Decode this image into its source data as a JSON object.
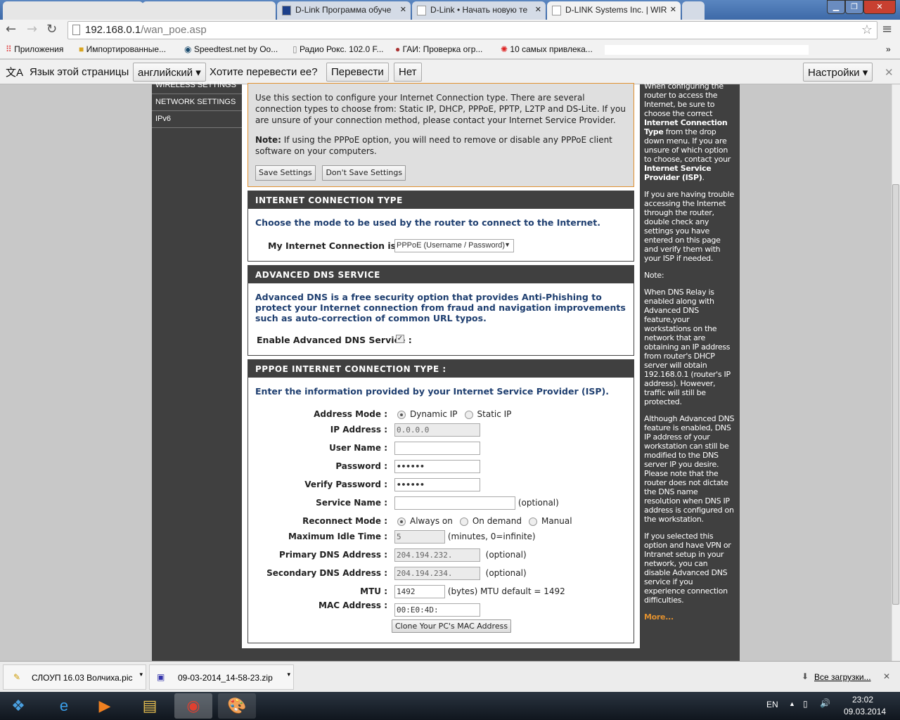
{
  "browser": {
    "tabs": [
      {
        "title": "D-Link Программа обуче"
      },
      {
        "title": "D-Link • Начать новую те"
      },
      {
        "title": "D-LINK Systems Inc. | WIR"
      }
    ],
    "url_host": "192.168.0.1",
    "url_path": "/wan_poe.asp",
    "bookmarks": [
      "Приложения",
      "Импортированные...",
      "Speedtest.net by Oo...",
      "Радио Рокс. 102.0 F...",
      "ГАИ: Проверка огр...",
      "10 самых привлека..."
    ],
    "translate": {
      "prefix": "Язык этой страницы",
      "language": "английский",
      "question": "Хотите перевести ее?",
      "translate": "Перевести",
      "no": "Нет",
      "settings": "Настройки"
    }
  },
  "nav": {
    "items": [
      "WIRELESS SETTINGS",
      "NETWORK SETTINGS",
      "IPv6"
    ]
  },
  "intro": {
    "text": "Use this section to configure your Internet Connection type. There are several connection types to choose from: Static IP, DHCP, PPPoE, PPTP, L2TP and DS-Lite. If you are unsure of your connection method, please contact your Internet Service Provider.",
    "note_label": "Note:",
    "note": " If using the PPPoE option, you will need to remove or disable any PPPoE client software on your computers.",
    "save": "Save Settings",
    "dont_save": "Don't Save Settings"
  },
  "ict": {
    "title": "INTERNET CONNECTION TYPE",
    "desc": "Choose the mode to be used by the router to connect to the Internet.",
    "label": "My Internet Connection is :",
    "value": "PPPoE (Username / Password)"
  },
  "dns": {
    "title": "ADVANCED DNS SERVICE",
    "desc": "Advanced DNS is a free security option that provides Anti-Phishing to protect your Internet connection from fraud and navigation improvements such as auto-correction of common URL typos.",
    "label": "Enable Advanced DNS Service :",
    "checked": true
  },
  "pppoe": {
    "title": "PPPOE INTERNET CONNECTION TYPE :",
    "desc": "Enter the information provided by your Internet Service Provider (ISP).",
    "address_mode": {
      "label": "Address Mode :",
      "opt1": "Dynamic IP",
      "opt2": "Static IP"
    },
    "ip": {
      "label": "IP Address :",
      "value": "0.0.0.0"
    },
    "user": {
      "label": "User Name :",
      "value": ""
    },
    "password": {
      "label": "Password :",
      "value": "••••••"
    },
    "verify": {
      "label": "Verify Password :",
      "value": "••••••"
    },
    "service": {
      "label": "Service Name :",
      "hint": "(optional)"
    },
    "reconnect": {
      "label": "Reconnect Mode :",
      "opt1": "Always on",
      "opt2": "On demand",
      "opt3": "Manual"
    },
    "idle": {
      "label": "Maximum Idle Time :",
      "value": "5",
      "hint": "(minutes, 0=infinite)"
    },
    "dns1": {
      "label": "Primary DNS Address :",
      "value": "204.194.232.",
      "hint": "(optional)"
    },
    "dns2": {
      "label": "Secondary DNS Address :",
      "value": "204.194.234.",
      "hint": "(optional)"
    },
    "mtu": {
      "label": "MTU :",
      "value": "1492",
      "hint": "(bytes) MTU default = 1492"
    },
    "mac": {
      "label": "MAC Address :",
      "value": "00:E0:4D:"
    },
    "clone": "Clone Your PC's MAC Address"
  },
  "help": {
    "p1a": "When configuring the router to access the Internet, be sure to choose the correct ",
    "p1b": "Internet Connection Type",
    "p1c": " from the drop down menu. If you are unsure of which option to choose, contact your ",
    "p1d": "Internet Service Provider (ISP)",
    "p1e": ".",
    "p2": "If you are having trouble accessing the Internet through the router, double check any settings you have entered on this page and verify them with your ISP if needed.",
    "p3": "Note:",
    "p4": "When DNS Relay is enabled along with Advanced DNS feature,your workstations on the network that are obtaining an IP address from router's DHCP server will obtain 192.168.0.1 (router's IP address). However, traffic will still be protected.",
    "p5": "Although Advanced DNS feature is enabled, DNS IP address of your workstation can still be modified to the DNS server IP you desire. Please note that the router does not dictate the DNS name resolution when DNS IP address is configured on the workstation.",
    "p6": "If you selected this option and have VPN or Intranet setup in your network, you can disable Advanced DNS service if you experience connection difficulties.",
    "more": "More..."
  },
  "downloads": {
    "items": [
      "СЛОУП 16.03 Волчиха.pic",
      "09-03-2014_14-58-23.zip"
    ],
    "all": "Все загрузки..."
  },
  "taskbar": {
    "lang": "EN",
    "time": "23:02",
    "date": "09.03.2014"
  }
}
